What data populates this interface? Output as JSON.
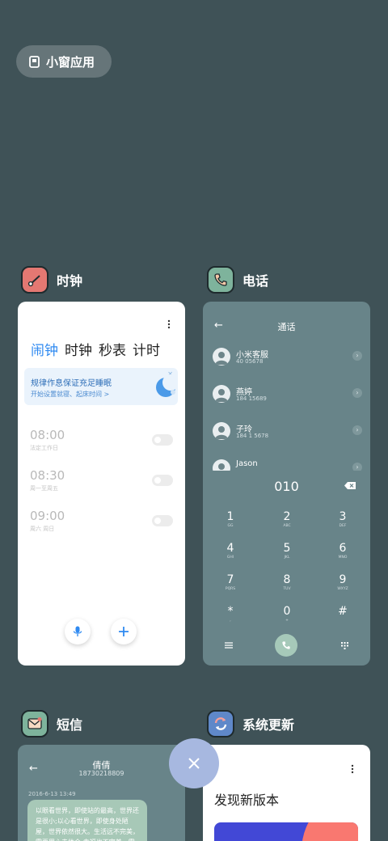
{
  "floating_window": {
    "label": "小窗应用"
  },
  "apps": {
    "clock": {
      "title": "时钟",
      "icon": "clock-icon",
      "color": "#e47872"
    },
    "phone": {
      "title": "电话",
      "icon": "phone-icon",
      "color": "#7eb39c"
    },
    "sms": {
      "title": "短信",
      "icon": "message-icon",
      "color": "#7eb39c"
    },
    "updater": {
      "title": "系统更新",
      "icon": "update-icon",
      "color": "#5f88c9"
    }
  },
  "clock": {
    "tabs": [
      "闹钟",
      "时钟",
      "秒表",
      "计时"
    ],
    "active_tab": 0,
    "promo_title": "规律作息保证充足睡眠",
    "promo_subtitle": "开始设置就寝、起床时间 >",
    "alarms": [
      {
        "time": "08:00",
        "repeat": "法定工作日",
        "enabled": false
      },
      {
        "time": "08:30",
        "repeat": "周一至周五",
        "enabled": false
      },
      {
        "time": "09:00",
        "repeat": "周六 周日",
        "enabled": false
      }
    ],
    "accent_color": "#2f8af1"
  },
  "phone": {
    "title": "通话",
    "contacts": [
      {
        "name": "小米客服",
        "number": "40  05678"
      },
      {
        "name": "燕婷",
        "number": "184   15689"
      },
      {
        "name": "子玲",
        "number": "184   1 5678"
      },
      {
        "name": "Jason",
        "number": ""
      }
    ],
    "dialed": "010",
    "keys": [
      {
        "d": "1",
        "l": "GG"
      },
      {
        "d": "2",
        "l": "ABC"
      },
      {
        "d": "3",
        "l": "DEF"
      },
      {
        "d": "4",
        "l": "GHI"
      },
      {
        "d": "5",
        "l": "JKL"
      },
      {
        "d": "6",
        "l": "MNO"
      },
      {
        "d": "7",
        "l": "PQRS"
      },
      {
        "d": "8",
        "l": "TUV"
      },
      {
        "d": "9",
        "l": "WXYZ"
      },
      {
        "d": "*",
        "l": ","
      },
      {
        "d": "0",
        "l": "+"
      },
      {
        "d": "#",
        "l": ""
      }
    ]
  },
  "sms": {
    "contact": "倩倩",
    "number": "18730218809",
    "date": "2016-6-13 13:49",
    "message": "以眼看世界，即使站的最高，世界还是很小;以心看世界，即使身处陋屋，世界依然很大。生活远不完美，需要用心去体会;幸福也不完美，需"
  },
  "updater": {
    "heading": "发现新版本"
  },
  "close_button_color": "#a7b8e0"
}
